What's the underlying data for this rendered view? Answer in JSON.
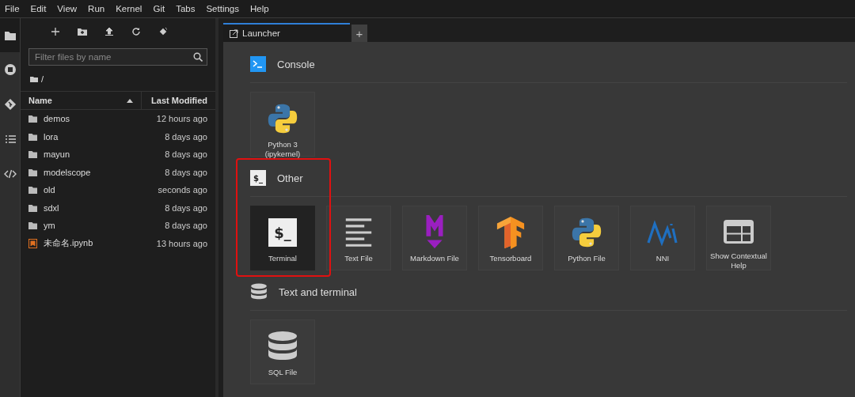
{
  "menu": [
    "File",
    "Edit",
    "View",
    "Run",
    "Kernel",
    "Git",
    "Tabs",
    "Settings",
    "Help"
  ],
  "activity_bar": [
    {
      "kind": "folder",
      "selected": true
    },
    {
      "kind": "stop",
      "selected": false
    },
    {
      "kind": "git",
      "selected": false
    },
    {
      "kind": "list",
      "selected": false
    },
    {
      "kind": "code",
      "selected": false
    }
  ],
  "file_browser": {
    "filter": {
      "placeholder": "Filter files by name"
    },
    "path": "/",
    "columns": [
      "Name",
      "Last Modified"
    ],
    "rows": [
      {
        "kind": "folder",
        "name": "demos",
        "modified": "12 hours ago"
      },
      {
        "kind": "folder",
        "name": "lora",
        "modified": "8 days ago"
      },
      {
        "kind": "folder",
        "name": "mayun",
        "modified": "8 days ago"
      },
      {
        "kind": "folder",
        "name": "modelscope",
        "modified": "8 days ago"
      },
      {
        "kind": "folder",
        "name": "old",
        "modified": "seconds ago"
      },
      {
        "kind": "folder",
        "name": "sdxl",
        "modified": "8 days ago"
      },
      {
        "kind": "folder",
        "name": "ym",
        "modified": "8 days ago"
      },
      {
        "kind": "notebook",
        "name": "未命名.ipynb",
        "modified": "13 hours ago"
      }
    ]
  },
  "tabs": [
    {
      "label": "Launcher",
      "selected": true
    }
  ],
  "new_tab": "+",
  "launcher": {
    "sections": [
      {
        "kind": "console",
        "title": "Console",
        "highlighted": false,
        "cards": [
          {
            "kind": "python",
            "label": "Python 3 (ipykernel)",
            "selected": false
          }
        ]
      },
      {
        "kind": "terminal",
        "glyph": "$_",
        "title": "Other",
        "highlighted": true,
        "cards": [
          {
            "kind": "terminal",
            "glyph": "$_",
            "label": "Terminal",
            "selected": true
          },
          {
            "kind": "text",
            "label": "Text File",
            "selected": false
          },
          {
            "kind": "markdown",
            "label": "Markdown File",
            "selected": false
          },
          {
            "kind": "tensorboard",
            "label": "Tensorboard",
            "selected": false
          },
          {
            "kind": "python",
            "label": "Python File",
            "selected": false
          },
          {
            "kind": "nni",
            "label": "NNI",
            "selected": false
          },
          {
            "kind": "help",
            "label": "Show Contextual Help",
            "selected": false
          }
        ]
      },
      {
        "kind": "database",
        "title": "Text and terminal",
        "highlighted": false,
        "cards": [
          {
            "kind": "database",
            "label": "SQL File",
            "selected": false
          }
        ]
      }
    ]
  }
}
